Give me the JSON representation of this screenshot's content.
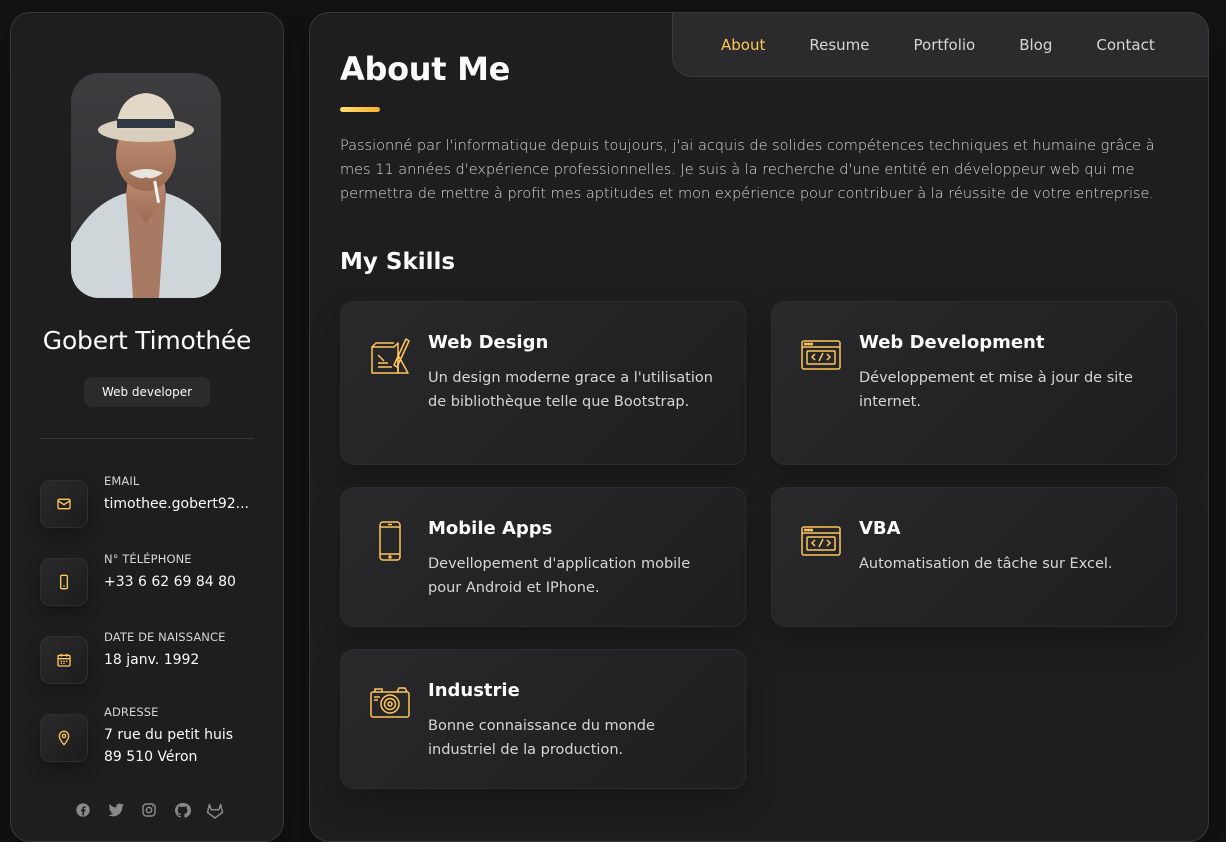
{
  "profile": {
    "name": "Gobert Timothée",
    "title": "Web developer"
  },
  "contacts": [
    {
      "label": "Email",
      "value": "timothee.gobert92..."
    },
    {
      "label": "N° téléphone",
      "value": "+33 6 62 69 84 80"
    },
    {
      "label": "Date de naissance",
      "value": "18 janv. 1992"
    },
    {
      "label": "Adresse",
      "value": "7 rue du petit huis\n89 510 Véron"
    }
  ],
  "nav": {
    "items": [
      "About",
      "Resume",
      "Portfolio",
      "Blog",
      "Contact"
    ],
    "active": "About"
  },
  "about": {
    "title": "About Me",
    "text": "Passionné par l'informatique depuis toujours, j'ai acquis de solides compétences techniques et humaine grâce à mes 11 années d'expérience professionnelles. Je suis à la recherche d'une entité en développeur web qui me permettra de mettre à profit mes aptitudes et mon expérience pour contribuer à la réussite de votre entreprise."
  },
  "skills": {
    "title": "My Skills",
    "items": [
      {
        "name": "Web Design",
        "desc": "Un design moderne grace a l'utilisation de bibliothèque telle que Bootstrap.",
        "icon": "design-icon"
      },
      {
        "name": "Web Development",
        "desc": "Développement et mise à jour de site internet.",
        "icon": "code-icon"
      },
      {
        "name": "Mobile Apps",
        "desc": "Devellopement d'application mobile pour Android et IPhone.",
        "icon": "mobile-icon"
      },
      {
        "name": "VBA",
        "desc": "Automatisation de tâche sur Excel.",
        "icon": "code-icon"
      },
      {
        "name": "Industrie",
        "desc": "Bonne connaissance du monde industriel de la production.",
        "icon": "camera-icon"
      }
    ]
  },
  "socials": [
    "facebook-icon",
    "twitter-icon",
    "instagram-icon",
    "github-icon",
    "gitlab-icon"
  ],
  "colors": {
    "accent": "#ffc65c",
    "background": "#121212",
    "panel": "#1e1e1f"
  }
}
